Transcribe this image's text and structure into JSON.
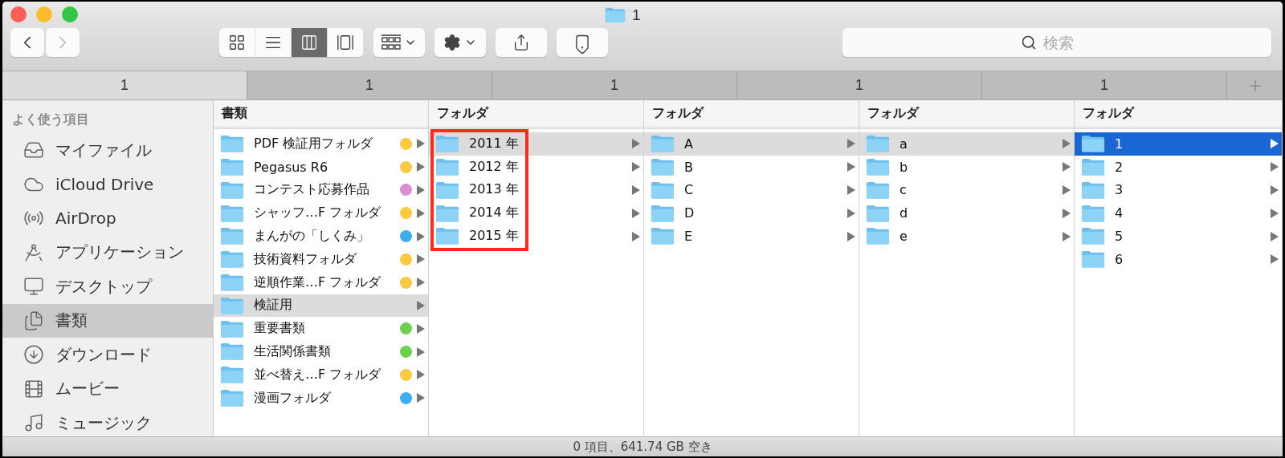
{
  "window": {
    "title": "1"
  },
  "toolbar": {
    "back": {
      "disabled": false
    },
    "forward": {
      "disabled": true
    },
    "view_modes": [
      {
        "kind": "icons",
        "selected": false
      },
      {
        "kind": "list",
        "selected": false
      },
      {
        "kind": "columns",
        "selected": true
      },
      {
        "kind": "coverflow",
        "selected": false
      }
    ],
    "search": {
      "placeholder": "検索"
    }
  },
  "tabs": [
    {
      "label": "1",
      "selected": true
    },
    {
      "label": "1",
      "selected": false
    },
    {
      "label": "1",
      "selected": false
    },
    {
      "label": "1",
      "selected": false
    },
    {
      "label": "1",
      "selected": false
    }
  ],
  "sidebar": {
    "section": "よく使う項目",
    "items": [
      {
        "kind": "files",
        "label": "マイファイル",
        "selected": false
      },
      {
        "kind": "cloud",
        "label": "iCloud Drive",
        "selected": false
      },
      {
        "kind": "airdrop",
        "label": "AirDrop",
        "selected": false
      },
      {
        "kind": "apps",
        "label": "アプリケーション",
        "selected": false
      },
      {
        "kind": "desktop",
        "label": "デスクトップ",
        "selected": false
      },
      {
        "kind": "documents",
        "label": "書類",
        "selected": true
      },
      {
        "kind": "download",
        "label": "ダウンロード",
        "selected": false
      },
      {
        "kind": "movies",
        "label": "ムービー",
        "selected": false
      },
      {
        "kind": "music",
        "label": "ミュージック",
        "selected": false
      }
    ]
  },
  "columns": [
    {
      "header": "書類",
      "focused": false,
      "annotated": false,
      "items": [
        {
          "label": "PDF 検証用フォルダ",
          "color": "#fcc93f",
          "selected": false
        },
        {
          "label": "Pegasus R6",
          "color": "#fcc93f",
          "selected": false
        },
        {
          "label": "コンテスト応募作品",
          "color": "#d98fd0",
          "selected": false
        },
        {
          "label": "シャッフ…F フォルダ",
          "color": "#fcc93f",
          "selected": false
        },
        {
          "label": "まんがの「しくみ」",
          "color": "#3eaef4",
          "selected": false
        },
        {
          "label": "技術資料フォルダ",
          "color": "#fcc93f",
          "selected": false
        },
        {
          "label": "逆順作業…F フォルダ",
          "color": "#fcc93f",
          "selected": false
        },
        {
          "label": "検証用",
          "selected": true
        },
        {
          "label": "重要書類",
          "color": "#6ad14f",
          "selected": false
        },
        {
          "label": "生活関係書類",
          "color": "#6ad14f",
          "selected": false
        },
        {
          "label": "並べ替え…F フォルダ",
          "color": "#fcc93f",
          "selected": false
        },
        {
          "label": "漫画フォルダ",
          "color": "#3eaef4",
          "selected": false
        }
      ]
    },
    {
      "header": "フォルダ",
      "focused": false,
      "annotated": true,
      "items": [
        {
          "label": "2011 年",
          "selected": true
        },
        {
          "label": "2012 年",
          "selected": false
        },
        {
          "label": "2013 年",
          "selected": false
        },
        {
          "label": "2014 年",
          "selected": false
        },
        {
          "label": "2015 年",
          "selected": false
        }
      ]
    },
    {
      "header": "フォルダ",
      "focused": false,
      "annotated": false,
      "items": [
        {
          "label": "A",
          "selected": true
        },
        {
          "label": "B",
          "selected": false
        },
        {
          "label": "C",
          "selected": false
        },
        {
          "label": "D",
          "selected": false
        },
        {
          "label": "E",
          "selected": false
        }
      ]
    },
    {
      "header": "フォルダ",
      "focused": false,
      "annotated": false,
      "items": [
        {
          "label": "a",
          "selected": true
        },
        {
          "label": "b",
          "selected": false
        },
        {
          "label": "c",
          "selected": false
        },
        {
          "label": "d",
          "selected": false
        },
        {
          "label": "e",
          "selected": false
        }
      ]
    },
    {
      "header": "フォルダ",
      "focused": true,
      "annotated": false,
      "items": [
        {
          "label": "1",
          "selected": true
        },
        {
          "label": "2",
          "selected": false
        },
        {
          "label": "3",
          "selected": false
        },
        {
          "label": "4",
          "selected": false
        },
        {
          "label": "5",
          "selected": false
        },
        {
          "label": "6",
          "selected": false
        }
      ]
    }
  ],
  "status_bar": "0 項目、641.74 GB 空き"
}
